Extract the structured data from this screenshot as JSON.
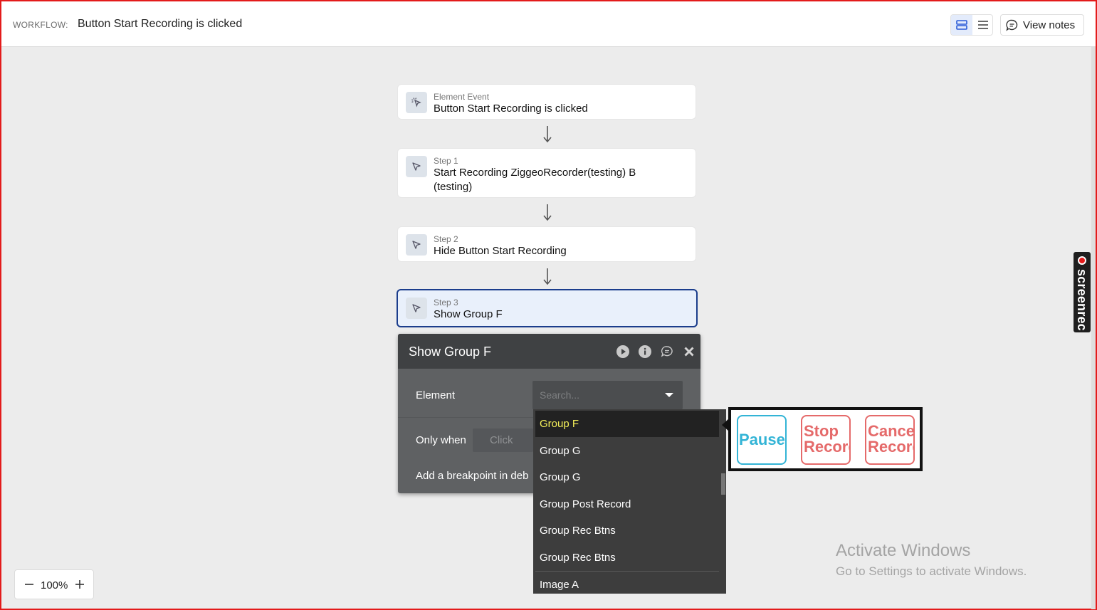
{
  "header": {
    "workflow_label": "WORKFLOW:",
    "workflow_title": "Button Start Recording is clicked",
    "view_notes_label": "View notes"
  },
  "steps": [
    {
      "kind": "Element Event",
      "name": "Button Start Recording is clicked",
      "icon": "cursor-click-icon"
    },
    {
      "kind": "Step 1",
      "name": "Start Recording ZiggeoRecorder(testing) B (testing)",
      "icon": "pointer-icon"
    },
    {
      "kind": "Step 2",
      "name": "Hide Button Start Recording",
      "icon": "pointer-icon"
    },
    {
      "kind": "Step 3",
      "name": "Show Group F",
      "icon": "pointer-icon"
    }
  ],
  "panel": {
    "title": "Show Group F",
    "element_label": "Element",
    "search_placeholder": "Search...",
    "only_when_label": "Only when",
    "click_placeholder": "Click",
    "breakpoint_label": "Add a breakpoint in deb"
  },
  "dropdown": {
    "items": [
      "Group F",
      "Group G",
      "Group G",
      "Group Post Record",
      "Group Rec Btns",
      "Group Rec Btns",
      "Image A"
    ],
    "highlighted_index": 0
  },
  "preview": {
    "buttons": [
      {
        "label": "Pause/R",
        "color": "#33b4d6"
      },
      {
        "label_line1": "Stop",
        "label_line2": "Recordi",
        "color": "#e56a6a"
      },
      {
        "label_line1": "Cance",
        "label_line2": "Record",
        "color": "#e56a6a"
      }
    ]
  },
  "screenrec": {
    "label": "screenrec"
  },
  "watermark": {
    "title": "Activate Windows",
    "subtitle": "Go to Settings to activate Windows."
  },
  "zoom": {
    "value": "100%"
  },
  "colors": {
    "selected_border": "#1b3d8c",
    "selected_bg": "#e9f0fb",
    "highlight_text": "#f5f05a",
    "frame": "#e31b1b"
  }
}
